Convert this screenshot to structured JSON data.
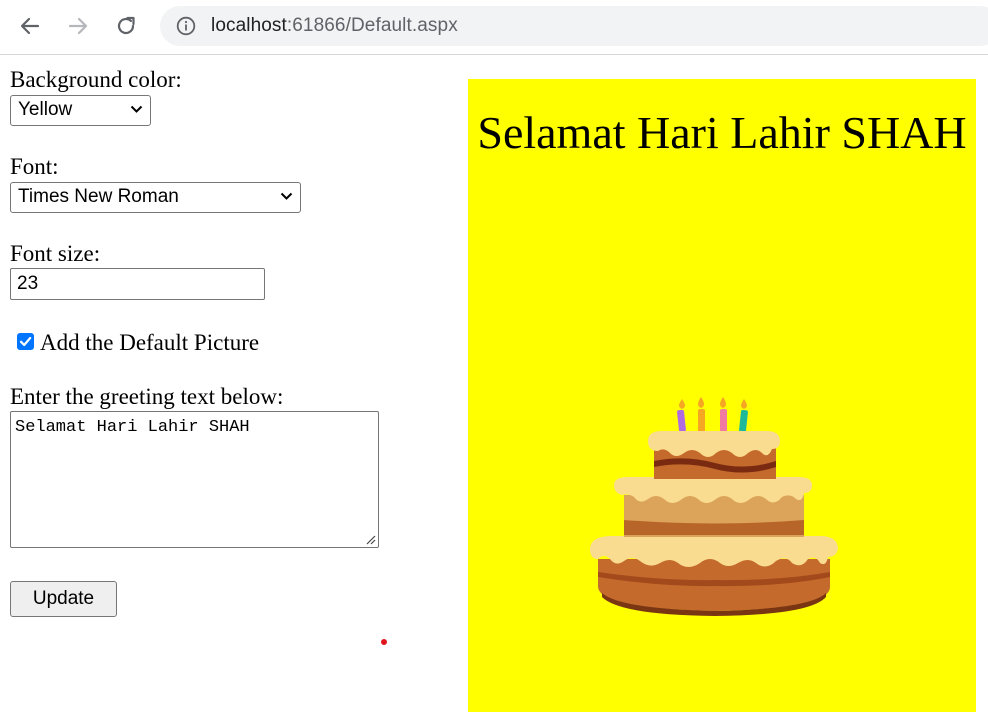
{
  "browser": {
    "url_host": "localhost",
    "url_rest": ":61866/Default.aspx"
  },
  "form": {
    "bg_label": "Background color:",
    "bg_value": "Yellow",
    "font_label": "Font:",
    "font_value": "Times New Roman",
    "size_label": "Font size:",
    "size_value": "23",
    "picture_label": "Add the Default Picture",
    "picture_checked": true,
    "greeting_label": "Enter the greeting text below:",
    "greeting_value": "Selamat Hari Lahir SHAH",
    "update_label": "Update"
  },
  "card": {
    "text": "Selamat Hari Lahir SHAH",
    "background": "#ffff00"
  },
  "icons": [
    "back-arrow-icon",
    "forward-arrow-icon",
    "reload-icon",
    "info-icon",
    "chevron-down-icon",
    "checkmark-icon",
    "resize-grip-icon",
    "birthday-cake-icon"
  ]
}
